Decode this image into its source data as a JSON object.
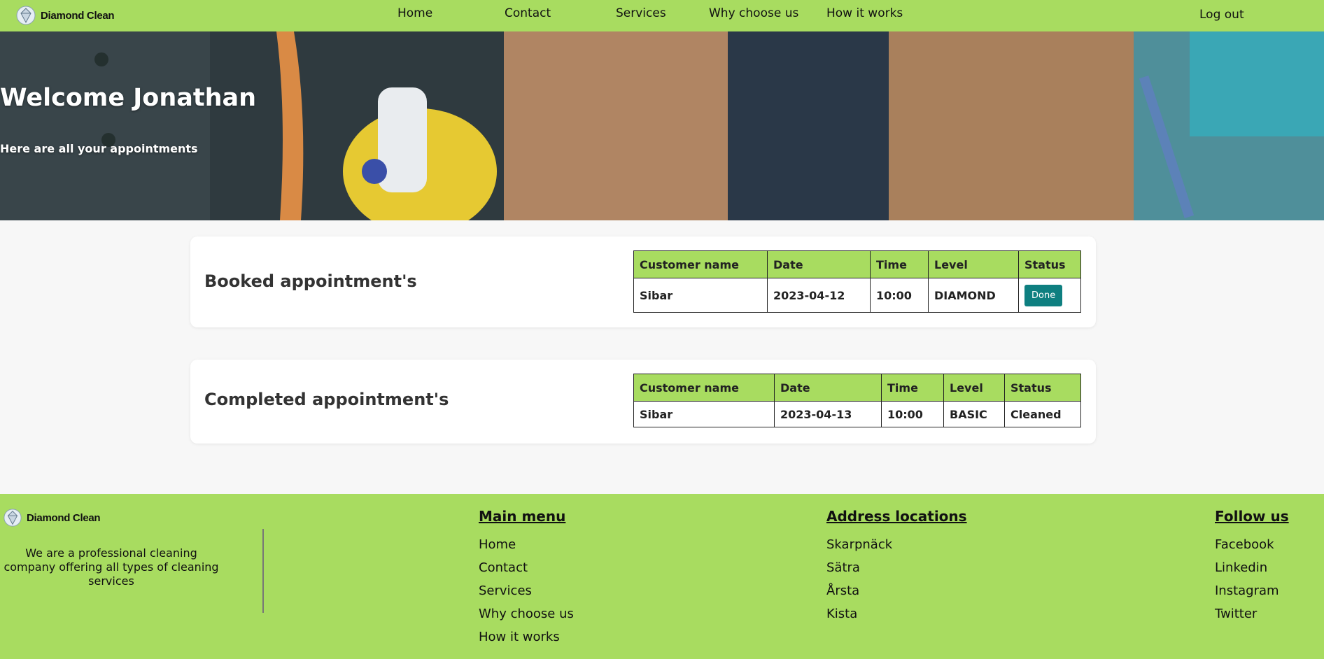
{
  "brand": {
    "name": "Diamond Clean",
    "logo_icon": "diamond-logo-icon"
  },
  "nav": {
    "items": [
      "Home",
      "Contact",
      "Services",
      "Why choose us",
      "How it works"
    ],
    "logout": "Log out"
  },
  "hero": {
    "title": "Welcome Jonathan",
    "subtitle": "Here are all your appointments"
  },
  "booked": {
    "title": "Booked appointment's",
    "headers": [
      "Customer name",
      "Date",
      "Time",
      "Level",
      "Status"
    ],
    "rows": [
      {
        "customer": "Sibar",
        "date": "2023-04-12",
        "time": "10:00",
        "level": "DIAMOND",
        "status": "Done"
      }
    ]
  },
  "completed": {
    "title": "Completed appointment's",
    "headers": [
      "Customer name",
      "Date",
      "Time",
      "Level",
      "Status"
    ],
    "rows": [
      {
        "customer": "Sibar",
        "date": "2023-04-13",
        "time": "10:00",
        "level": "BASIC",
        "status": "Cleaned"
      }
    ]
  },
  "footer": {
    "brand": "Diamond Clean",
    "description": "We are a professional cleaning company offering all types of cleaning services",
    "main_menu": {
      "title": "Main menu",
      "items": [
        "Home",
        "Contact",
        "Services",
        "Why choose us",
        "How it works"
      ]
    },
    "addresses": {
      "title": "Address locations",
      "items": [
        "Skarpnäck",
        "Sätra",
        "Årsta",
        "Kista"
      ]
    },
    "follow": {
      "title": "Follow us",
      "items": [
        "Facebook",
        "Linkedin",
        "Instagram",
        "Twitter"
      ]
    }
  },
  "colors": {
    "accent": "#a8dc60",
    "button": "#0e7f80",
    "background": "#f7f7f7"
  }
}
